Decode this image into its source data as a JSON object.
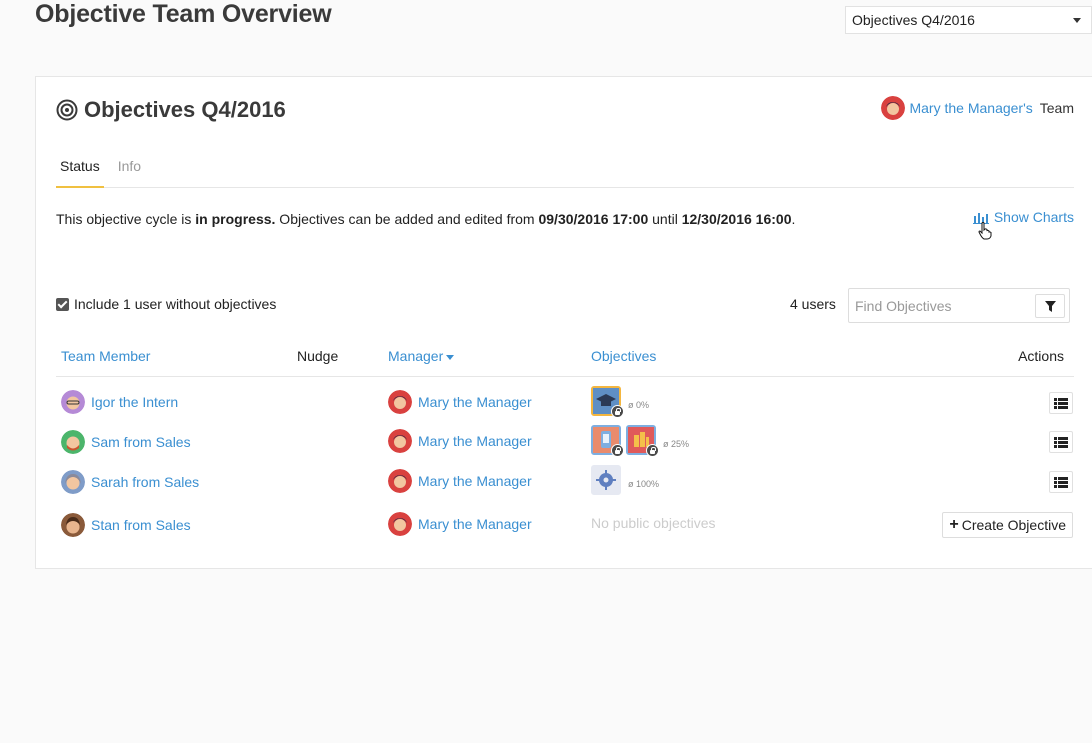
{
  "page": {
    "title": "Objective Team Overview"
  },
  "cycle_select": {
    "value": "Objectives Q4/2016"
  },
  "card": {
    "title": "Objectives Q4/2016",
    "team_owner": "Mary the Manager's",
    "team_word": "Team",
    "tabs": [
      {
        "label": "Status"
      },
      {
        "label": "Info"
      }
    ],
    "status": {
      "prefix": "This objective cycle is ",
      "state": "in progress.",
      "middle": " Objectives can be added and edited from ",
      "start": "09/30/2016 17:00",
      "until": " until ",
      "end": "12/30/2016 16:00",
      "suffix": "."
    },
    "show_charts": "Show Charts",
    "include_label": "Include 1 user without objectives",
    "users_count": "4 users",
    "find_placeholder": "Find Objectives"
  },
  "table": {
    "headers": {
      "member": "Team Member",
      "nudge": "Nudge",
      "manager": "Manager",
      "objectives": "Objectives",
      "actions": "Actions"
    },
    "rows": [
      {
        "member": "Igor the Intern",
        "manager": "Mary the Manager",
        "progress": "ø 0%"
      },
      {
        "member": "Sam from Sales",
        "manager": "Mary the Manager",
        "progress": "ø 25%"
      },
      {
        "member": "Sarah from Sales",
        "manager": "Mary the Manager",
        "progress": "ø 100%"
      },
      {
        "member": "Stan from Sales",
        "manager": "Mary the Manager",
        "no_objectives": "No public objectives",
        "create_label": "Create Objective"
      }
    ]
  },
  "colors": {
    "link": "#3a8fd1",
    "tab_underline": "#f0c040",
    "avatar_manager": "#d9413f"
  }
}
